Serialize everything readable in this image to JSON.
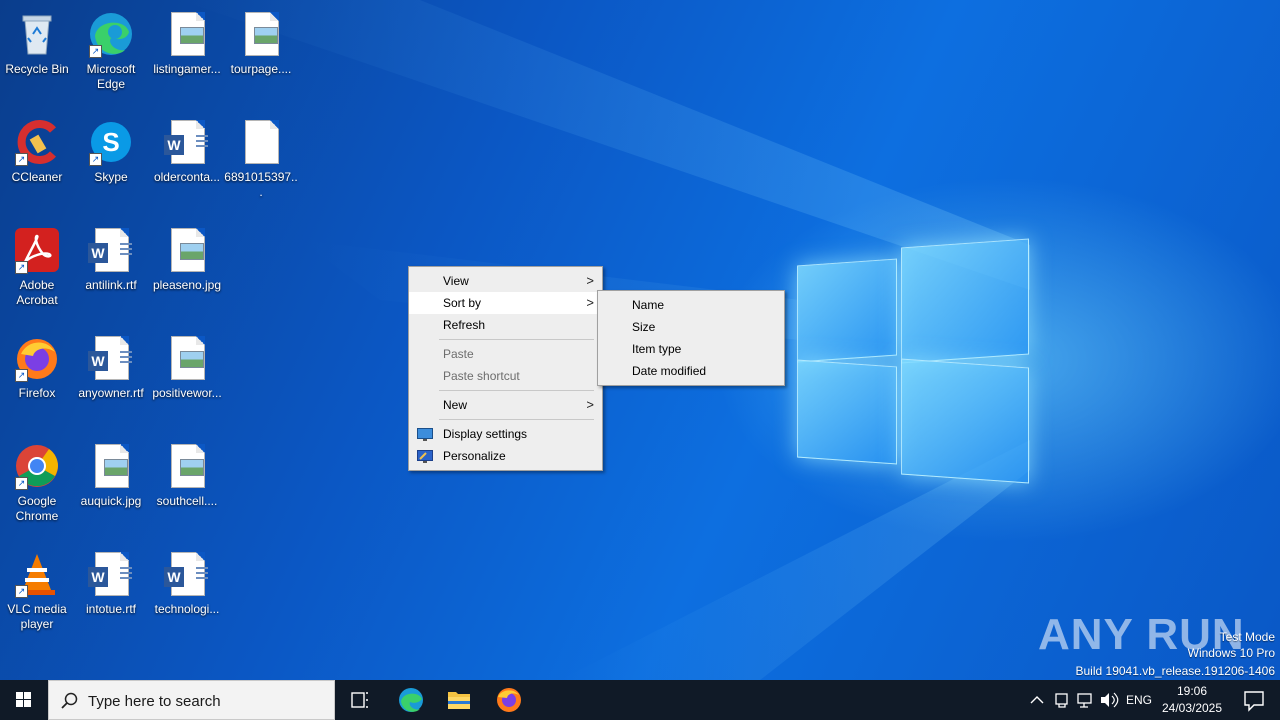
{
  "desktop_icons": [
    {
      "label": "Recycle Bin",
      "icon": "recycle-bin-icon"
    },
    {
      "label": "Microsoft Edge",
      "icon": "edge-icon"
    },
    {
      "label": "listingamer...",
      "icon": "image-file-icon"
    },
    {
      "label": "tourpage....",
      "icon": "image-file-icon"
    },
    {
      "label": "CCleaner",
      "icon": "ccleaner-icon"
    },
    {
      "label": "Skype",
      "icon": "skype-icon"
    },
    {
      "label": "olderconta...",
      "icon": "word-file-icon"
    },
    {
      "label": "6891015397...",
      "icon": "blank-file-icon"
    },
    {
      "label": "Adobe Acrobat",
      "icon": "acrobat-icon"
    },
    {
      "label": "antilink.rtf",
      "icon": "word-file-icon"
    },
    {
      "label": "pleaseno.jpg",
      "icon": "image-file-icon"
    },
    {
      "label": "Firefox",
      "icon": "firefox-icon"
    },
    {
      "label": "anyowner.rtf",
      "icon": "word-file-icon"
    },
    {
      "label": "positivewor...",
      "icon": "image-file-icon"
    },
    {
      "label": "Google Chrome",
      "icon": "chrome-icon"
    },
    {
      "label": "auquick.jpg",
      "icon": "image-file-icon"
    },
    {
      "label": "southcell....",
      "icon": "image-file-icon"
    },
    {
      "label": "VLC media player",
      "icon": "vlc-icon"
    },
    {
      "label": "intotue.rtf",
      "icon": "word-file-icon"
    },
    {
      "label": "technologi...",
      "icon": "word-file-icon"
    }
  ],
  "context_menu": {
    "items": [
      "View",
      "Sort by",
      "Refresh",
      "Paste",
      "Paste shortcut",
      "New",
      "Display settings",
      "Personalize"
    ],
    "arrow": ">"
  },
  "sort_submenu": {
    "items": [
      "Name",
      "Size",
      "Item type",
      "Date modified"
    ]
  },
  "watermark": {
    "brand": "ANY RUN",
    "line1": "Test Mode",
    "line2": "Windows 10 Pro",
    "line3": "Build 19041.vb_release.191206-1406"
  },
  "taskbar": {
    "search_placeholder": "Type here to search",
    "language": "ENG",
    "time": "19:06",
    "date": "24/03/2025"
  },
  "colors": {
    "desktop_blue": "#0b57c4",
    "taskbar": "#101a27",
    "menu_bg": "#eeeeee"
  }
}
